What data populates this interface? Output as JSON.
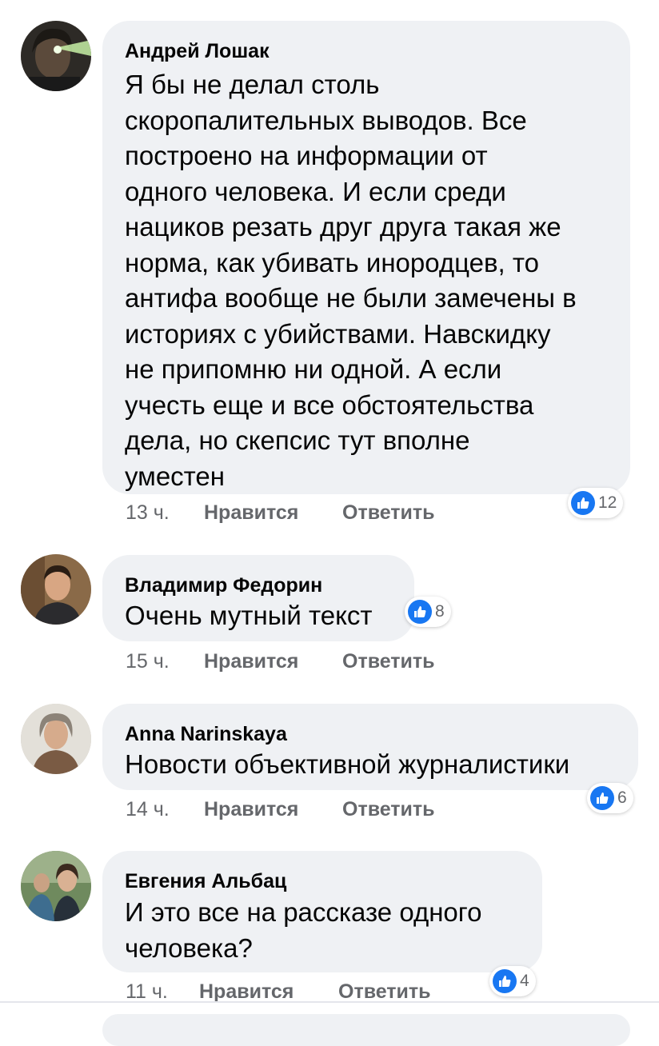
{
  "comments": [
    {
      "author": "Андрей Лошак",
      "lines": [
        "Я бы не делал столь",
        "скоропалительных выводов. Все",
        "построено на информации от",
        "одного человека. И если среди",
        "нациков резать друг друга такая же",
        "норма, как убивать инородцев, то",
        "антифа вообще не были замечены в",
        "историях с убийствами. Навскидку",
        "не припомню ни одной. А если",
        "учесть еще и все обстоятельства",
        "дела, но скепсис тут вполне",
        "уместен"
      ],
      "time": "13 ч.",
      "like_label": "Нравится",
      "reply_label": "Ответить",
      "reactions": "12"
    },
    {
      "author": "Владимир Федорин",
      "lines": [
        "Очень мутный текст"
      ],
      "time": "15 ч.",
      "like_label": "Нравится",
      "reply_label": "Ответить",
      "reactions": "8"
    },
    {
      "author": "Anna Narinskaya",
      "lines": [
        "Новости объективной журналистики"
      ],
      "time": "14 ч.",
      "like_label": "Нравится",
      "reply_label": "Ответить",
      "reactions": "6"
    },
    {
      "author": "Евгения Альбац",
      "lines": [
        "И это все на рассказе одного",
        "человека?"
      ],
      "time": "11 ч.",
      "like_label": "Нравится",
      "reply_label": "Ответить",
      "reactions": "4"
    }
  ],
  "icons": {
    "reaction": "like-thumb-icon"
  },
  "colors": {
    "like_blue": "#1877f2",
    "bubble": "#eff1f4",
    "meta_gray": "#65676b"
  }
}
